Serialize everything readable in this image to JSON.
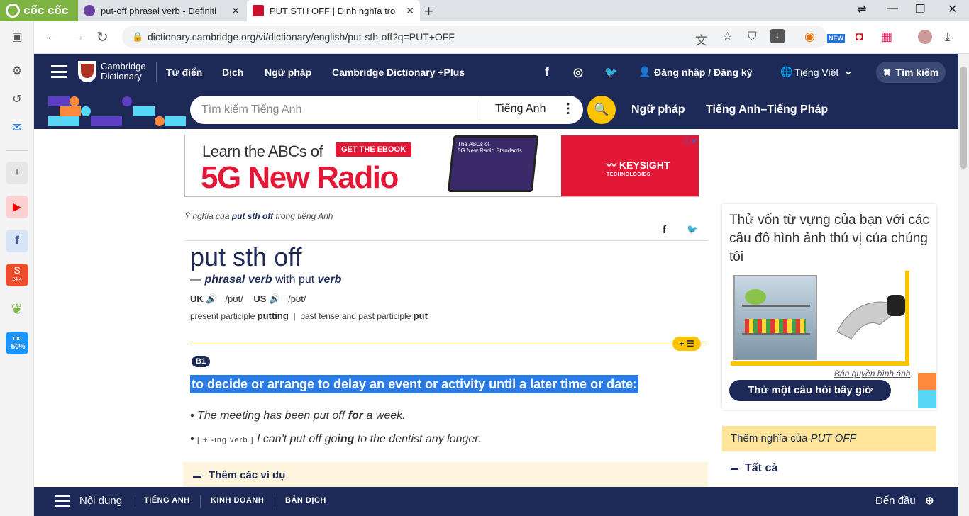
{
  "browser": {
    "brand": "cốc cốc",
    "tabs": [
      {
        "title": "put-off phrasal verb - Definiti",
        "active": false
      },
      {
        "title": "PUT STH OFF | Định nghĩa tro",
        "active": true
      }
    ],
    "url": "dictionary.cambridge.org/vi/dictionary/english/put-sth-off?q=PUT+OFF",
    "new_badge": "NEW"
  },
  "sidebar": {
    "shopee_badge": "24.4",
    "tiki_label": "TIKI",
    "tiki_badge": "-50%"
  },
  "site": {
    "logo_line1": "Cambridge",
    "logo_line2": "Dictionary",
    "nav": [
      "Từ điển",
      "Dịch",
      "Ngữ pháp",
      "Cambridge Dictionary +Plus"
    ],
    "login": "Đăng nhập / Đăng ký",
    "language": "Tiếng Việt",
    "search_button": "Tìm kiếm",
    "search_placeholder": "Tìm kiếm Tiếng Anh",
    "search_lang": "Tiếng Anh",
    "nav2": [
      "Ngữ pháp",
      "Tiếng Anh–Tiếng Pháp"
    ]
  },
  "ad": {
    "learn": "Learn the ABCs of",
    "cta": "GET THE EBOOK",
    "headline": "5G New Radio",
    "tablet_line1": "The ABCs of",
    "tablet_line2": "5G New Radio Standards",
    "brand": "KEYSIGHT",
    "brand_sub": "TECHNOLOGIES"
  },
  "entry": {
    "meaning_prefix": "Ý nghĩa của",
    "meaning_word": "put sth off",
    "meaning_suffix": "trong tiếng Anh",
    "headword": "put sth off",
    "pos_dash": "—",
    "pos": "phrasal verb",
    "with": "with put",
    "verb": "verb",
    "uk": "UK",
    "uk_ipa": "/pʊt/",
    "us": "US",
    "us_ipa": "/pʊt/",
    "pp_label": "present participle",
    "pp": "putting",
    "pt_label": "past tense and past participle",
    "pt": "put",
    "level": "B1",
    "definition": "to decide or arrange to delay an event or activity until a later time or date:",
    "ex1_a": "The meeting has been put off",
    "ex1_b": "for",
    "ex1_c": "a week.",
    "ex2_gram": "[ + -ing verb ]",
    "ex2_a": "I can't put off go",
    "ex2_b": "ing",
    "ex2_c": "to the dentist any longer.",
    "more_examples": "Thêm các ví dụ"
  },
  "quiz": {
    "prompt": "Thử vốn từ vựng của bạn với các câu đố hình ảnh thú vị của chúng tôi",
    "copyright": "Bản quyền hình ảnh",
    "button": "Thử một câu hỏi bây giờ"
  },
  "more_meanings": {
    "label": "Thêm nghĩa của",
    "word": "PUT OFF",
    "all": "Tất cả"
  },
  "bottombar": {
    "contents": "Nội dung",
    "items": [
      "TIẾNG ANH",
      "KINH DOANH",
      "BẢN DỊCH"
    ],
    "top": "Đến đầu"
  },
  "colors": {
    "navy": "#1d2a57",
    "yellow": "#fec400",
    "highlight": "#2a7be4",
    "ad_red": "#e31837"
  }
}
